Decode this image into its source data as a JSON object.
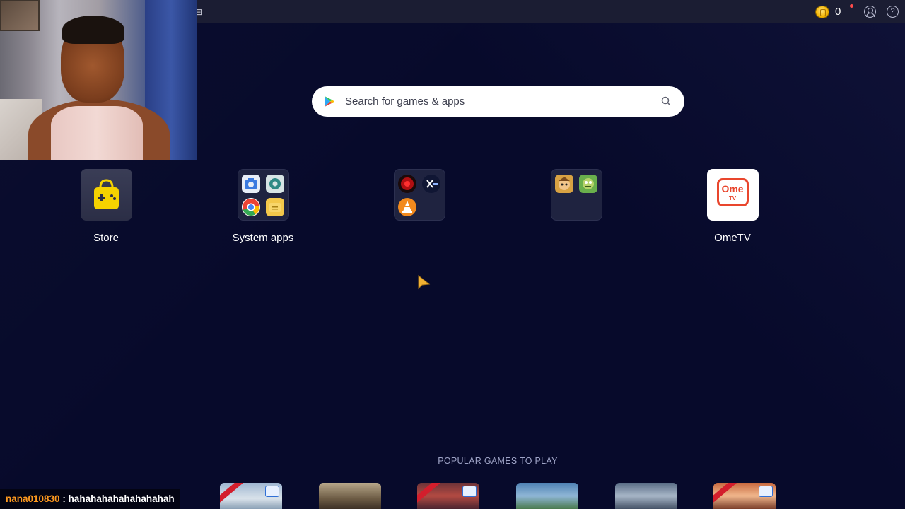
{
  "topbar": {
    "coins": "0",
    "menu_glyph": "⊟"
  },
  "search": {
    "placeholder": "Search for games & apps"
  },
  "apps": [
    {
      "label": "Store"
    },
    {
      "label": "System apps"
    },
    {
      "label": ""
    },
    {
      "label": ""
    },
    {
      "label": "OmeTV"
    }
  ],
  "ometv_logo": {
    "word": "Ome",
    "sub": "TV"
  },
  "popular": {
    "heading": "POPULAR GAMES TO PLAY"
  },
  "chat": {
    "username": "nana010830",
    "separator": " : ",
    "message": "hahahahahahahahahah"
  },
  "colors": {
    "background": "#070a2b",
    "topbar": "#1b1d33",
    "accent_orange": "#e9462d",
    "coin": "#f4b400",
    "chat_user": "#ff9a1f"
  }
}
